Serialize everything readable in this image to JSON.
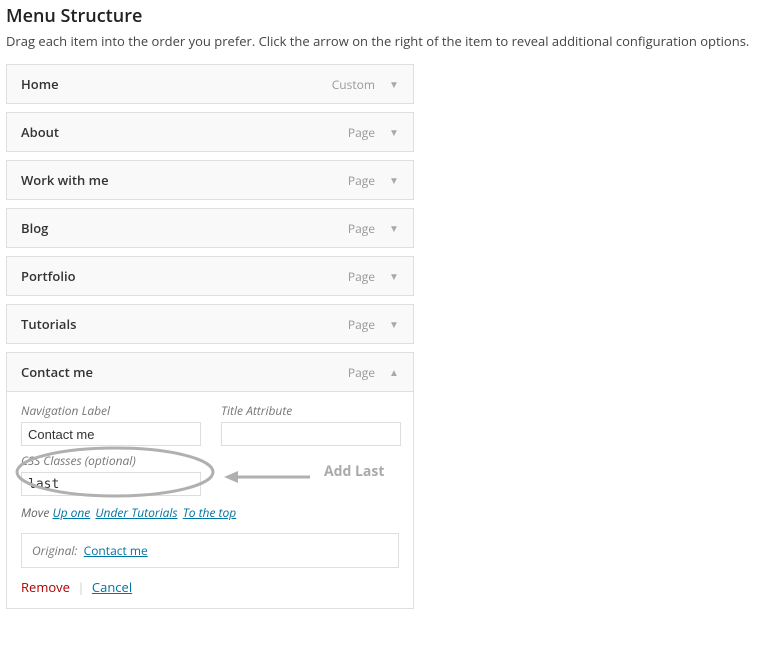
{
  "header": {
    "title": "Menu Structure",
    "description": "Drag each item into the order you prefer. Click the arrow on the right of the item to reveal additional configuration options."
  },
  "menu_items": [
    {
      "title": "Home",
      "type": "Custom",
      "expanded": false
    },
    {
      "title": "About",
      "type": "Page",
      "expanded": false
    },
    {
      "title": "Work with me",
      "type": "Page",
      "expanded": false
    },
    {
      "title": "Blog",
      "type": "Page",
      "expanded": false
    },
    {
      "title": "Portfolio",
      "type": "Page",
      "expanded": false
    },
    {
      "title": "Tutorials",
      "type": "Page",
      "expanded": false
    },
    {
      "title": "Contact me",
      "type": "Page",
      "expanded": true
    }
  ],
  "expanded_item": {
    "nav_label_label": "Navigation Label",
    "nav_label_value": "Contact me",
    "title_attr_label": "Title Attribute",
    "title_attr_value": "",
    "css_classes_label": "CSS Classes (optional)",
    "css_classes_value": "last",
    "move_label": "Move",
    "move_links": {
      "up_one": "Up one",
      "under": "Under Tutorials",
      "to_top": "To the top"
    },
    "original_label": "Original:",
    "original_link": "Contact me",
    "remove_label": "Remove",
    "cancel_label": "Cancel"
  },
  "annotation": {
    "label": "Add Last"
  }
}
